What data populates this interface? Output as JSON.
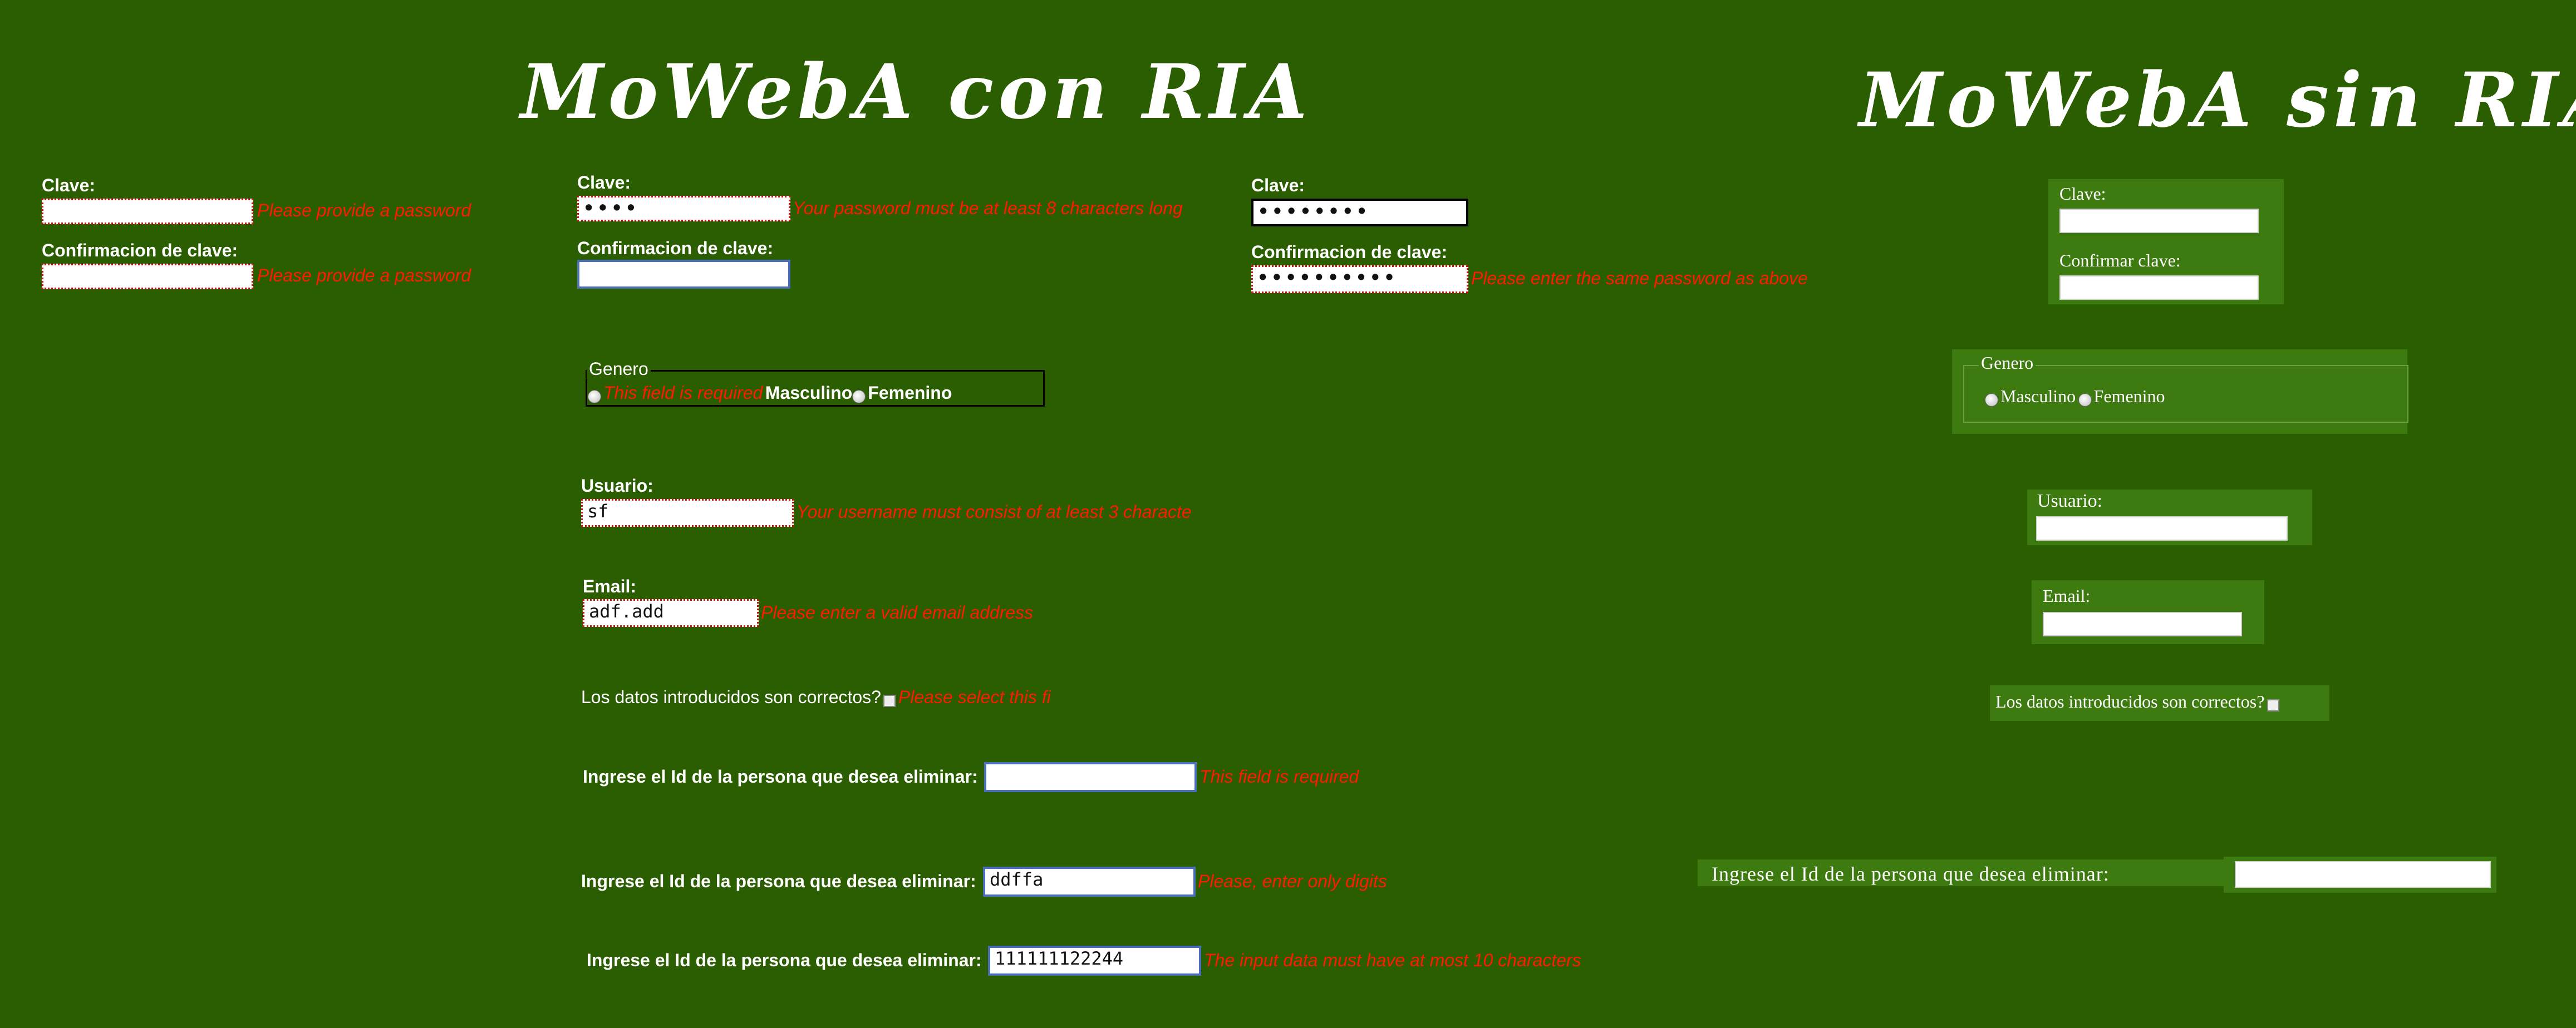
{
  "titles": {
    "con": "MoWebA con RIA",
    "sin": "MoWebA sin RIA"
  },
  "colors": {
    "background": "#2a5e00",
    "error": "#ff1a00",
    "panel": "#3d7a10"
  },
  "col1": {
    "clave_label": "Clave:",
    "clave_error": "Please provide a password",
    "confirm_label": "Confirmacion de clave:",
    "confirm_error": "Please provide a password"
  },
  "col2": {
    "clave_label": "Clave:",
    "clave_value": "••••",
    "clave_error": "Your password must be at least 8 characters long",
    "confirm_label": "Confirmacion de clave:",
    "genero_legend": "Genero",
    "genero_error": "This field is required",
    "genero_masculino": "Masculino",
    "genero_femenino": "Femenino",
    "usuario_label": "Usuario:",
    "usuario_value": "sf",
    "usuario_error": "Your username must consist of at least 3 characte",
    "email_label": "Email:",
    "email_value": "adf.add",
    "email_error": "Please enter a valid email address",
    "datos_label": "Los datos introducidos son correctos?",
    "datos_error": "Please select this fi",
    "id1_label": "Ingrese el Id de la persona que desea eliminar:",
    "id1_error": "This field is required",
    "id2_label": "Ingrese el Id de la persona que desea eliminar:",
    "id2_value": "ddffa",
    "id2_error": "Please, enter only digits",
    "id3_label": "Ingrese el Id de la persona que desea eliminar:",
    "id3_value": "111111122244",
    "id3_error": "The input data must have at most 10 characters"
  },
  "col3": {
    "clave_label": "Clave:",
    "clave_value": "••••••••",
    "confirm_label": "Confirmacion de clave:",
    "confirm_value": "••••••••••",
    "confirm_error": "Please enter the same password as above"
  },
  "sin": {
    "clave_label": "Clave:",
    "confirmar_label": "Confirmar clave:",
    "genero_legend": "Genero",
    "genero_masculino": "Masculino",
    "genero_femenino": "Femenino",
    "usuario_label": "Usuario:",
    "email_label": "Email:",
    "datos_label": "Los datos introducidos son correctos?",
    "id_label": "Ingrese el Id de la persona que desea eliminar:"
  }
}
